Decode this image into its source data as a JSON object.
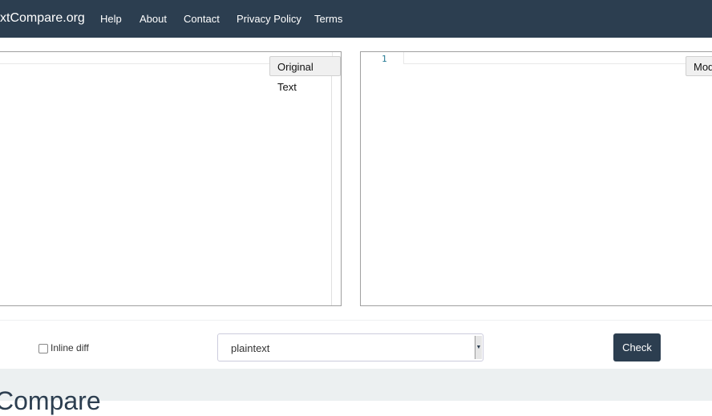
{
  "navbar": {
    "brand": "xtCompare.org",
    "links": [
      "Help",
      "About",
      "Contact",
      "Privacy Policy",
      "Terms"
    ]
  },
  "editors": {
    "original_label": "Original Text",
    "modified_label": "Mod",
    "line_number": "1"
  },
  "controls": {
    "inline_diff_label": "Inline diff",
    "inline_diff_checked": false,
    "language_value": "plaintext",
    "check_label": "Check"
  },
  "section": {
    "heading": "Compare"
  }
}
